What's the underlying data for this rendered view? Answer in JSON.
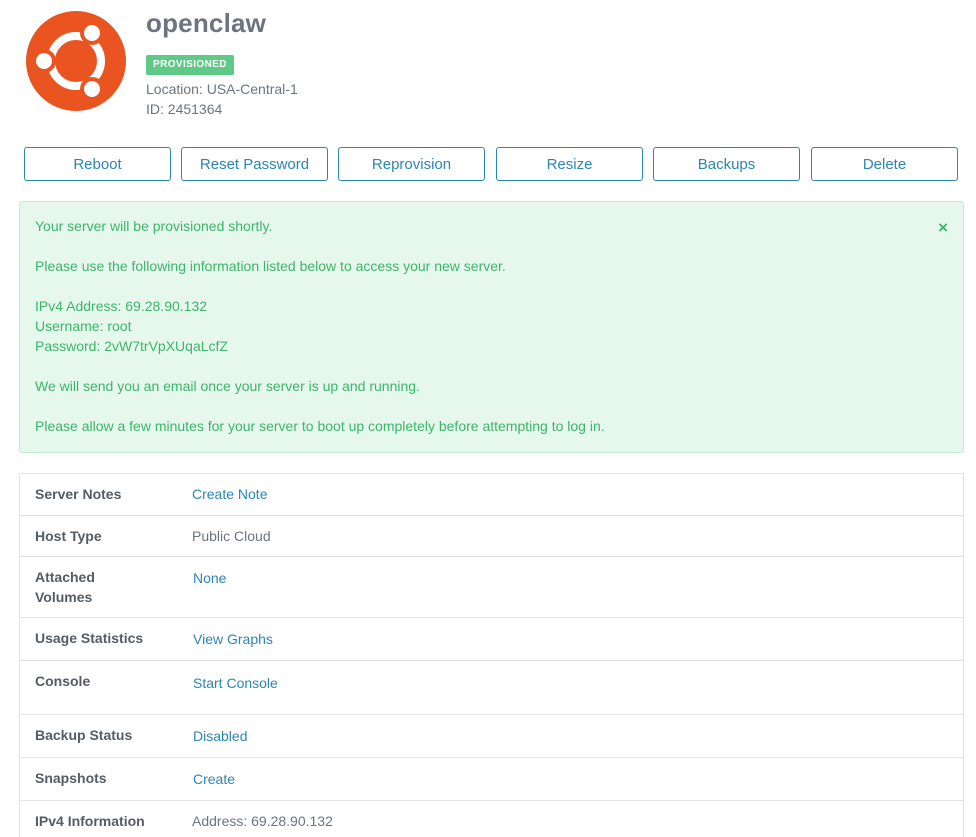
{
  "server": {
    "name": "openclaw",
    "status": "PROVISIONED",
    "location": "Location: USA-Central-1",
    "id": "ID: 2451364",
    "logo": "ubuntu-logo",
    "colors": {
      "logo": "#e95420",
      "status": "#5fc987",
      "accent": "#2b86b4"
    }
  },
  "actions": {
    "reboot": "Reboot",
    "reset_password": "Reset Password",
    "reprovision": "Reprovision",
    "resize": "Resize",
    "backups": "Backups",
    "delete": "Delete"
  },
  "alert": {
    "close": "×",
    "line1": "Your server will be provisioned shortly.",
    "line2": "Please use the following information listed below to access your new server.",
    "ipv4": "IPv4 Address: 69.28.90.132",
    "username": "Username: root",
    "password": "Password: 2vW7trVpXUqaLcfZ",
    "email": "We will send you an email once your server is up and running.",
    "allow": "Please allow a few minutes for your server to boot up completely before attempting to log in."
  },
  "details": {
    "server_notes": {
      "label": "Server Notes",
      "value": "Create Note"
    },
    "host_type": {
      "label": "Host Type",
      "value": "Public Cloud"
    },
    "attached_volumes": {
      "label_line1": "Attached",
      "label_line2": "Volumes",
      "value": "None"
    },
    "usage_statistics": {
      "label": "Usage Statistics",
      "value": "View Graphs"
    },
    "console": {
      "label": "Console",
      "value": "Start Console"
    },
    "backup_status": {
      "label": "Backup Status",
      "value": "Disabled"
    },
    "snapshots": {
      "label": "Snapshots",
      "value": "Create"
    },
    "ipv4_information": {
      "label": "IPv4 Information",
      "value": "Address: 69.28.90.132"
    }
  }
}
